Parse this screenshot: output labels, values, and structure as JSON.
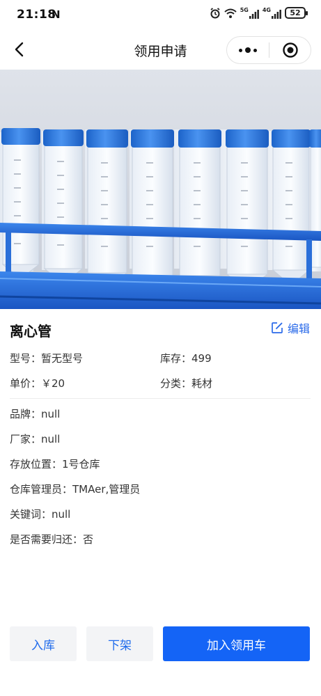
{
  "status_bar": {
    "time": "21:18",
    "n_indicator": "N",
    "network_5g": "5G",
    "network_4g": "4G",
    "battery": "52"
  },
  "nav": {
    "title": "领用申请"
  },
  "product": {
    "name": "离心管",
    "edit_label": "编辑",
    "image_description": "centrifuge-tubes-in-blue-rack"
  },
  "info": {
    "model": "型号：暂无型号",
    "stock": "库存：499",
    "price": "单价：￥20",
    "category": "分类：耗材"
  },
  "details": [
    "品牌：null",
    "厂家：null",
    "存放位置：1号仓库",
    "仓库管理员：TMAer,管理员",
    "关键词：null",
    "是否需要归还：否"
  ],
  "actions": {
    "stock_in": "入库",
    "take_down": "下架",
    "add_to_cart": "加入领用车"
  },
  "colors": {
    "primary": "#1464f6",
    "link": "#2a6ae9",
    "secondary_bg": "#f3f4f6"
  }
}
